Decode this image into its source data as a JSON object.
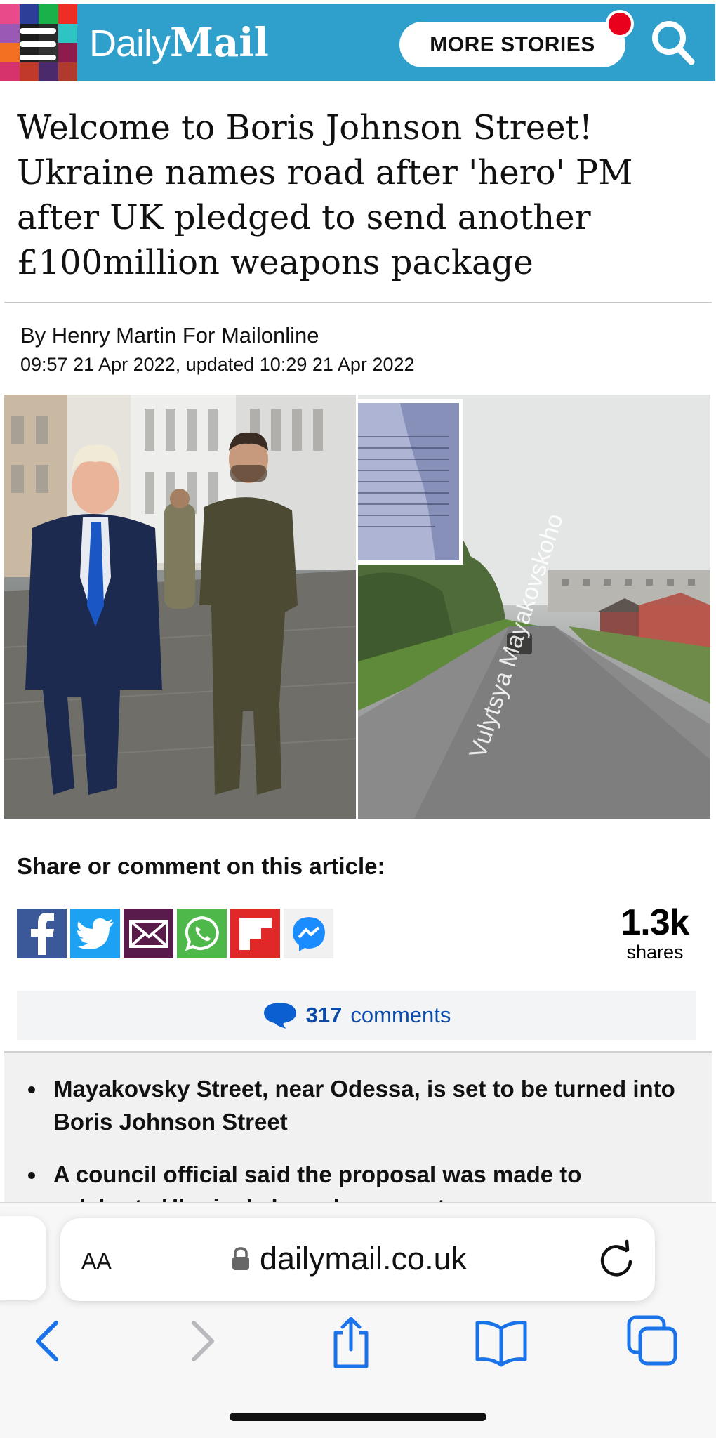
{
  "header": {
    "logo_daily": "Daily",
    "logo_mail": "Mail",
    "more_stories": "MORE STORIES",
    "brand_color": "#2f9fcc",
    "notification_color": "#e8001c"
  },
  "article": {
    "headline": "Welcome to Boris Johnson Street! Ukraine names road after 'hero' PM after UK pledged to send another £100million weapons package",
    "byline": "By Henry Martin For Mailonline",
    "dateline": "09:57 21 Apr 2022, updated 10:29 21 Apr 2022",
    "street_sign_text": "Vulytsya Mayakovskoho"
  },
  "share": {
    "title": "Share or comment on this article:",
    "icons": [
      "facebook-icon",
      "twitter-icon",
      "email-icon",
      "whatsapp-icon",
      "flipboard-icon",
      "messenger-icon"
    ],
    "count": "1.3k",
    "count_label": "shares"
  },
  "comments": {
    "count": "317",
    "label": "comments",
    "link_color": "#0b4aa8"
  },
  "bullets": [
    "Mayakovsky Street, near Odessa, is set to be turned into Boris Johnson Street",
    "A council official said the proposal was made to celebrate Ukraine's bravely supporter"
  ],
  "browser": {
    "aa_label": "AA",
    "url": "dailymail.co.uk",
    "accent_color": "#1a73e8"
  }
}
